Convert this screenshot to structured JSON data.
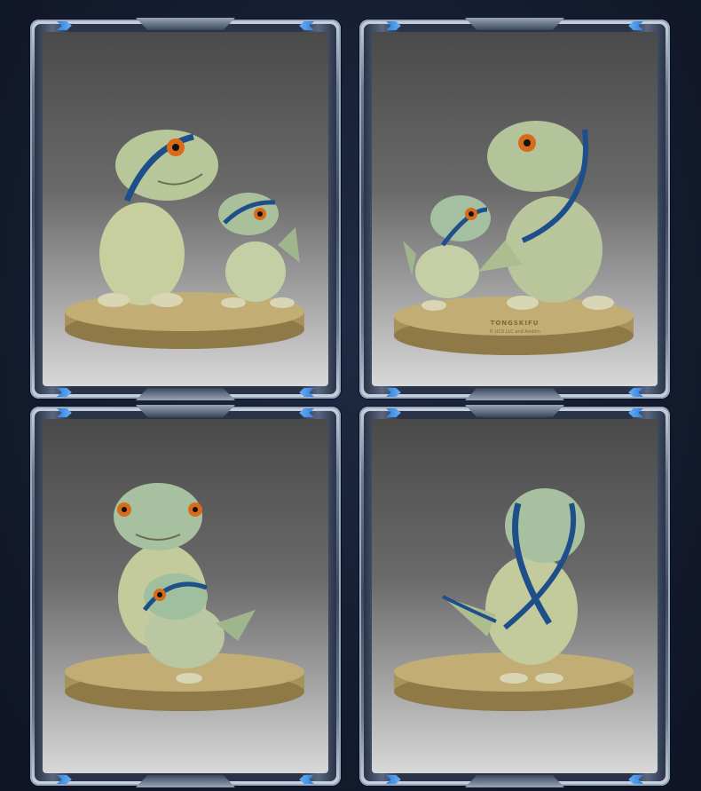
{
  "figure": {
    "base_text": "TONGSKIFU",
    "base_subtext": "© UCS LLC and Amblin"
  },
  "colors": {
    "background": "#141b2e",
    "frame_accent": "#8fd0ff",
    "base_gold": "#b8a36a",
    "skin": "#c7cf9f",
    "stripe_blue": "#1e4f8a",
    "eye_orange": "#d86a1a"
  },
  "panels": [
    {
      "view": "front-pair"
    },
    {
      "view": "side-pair-with-label"
    },
    {
      "view": "stacked-front"
    },
    {
      "view": "back"
    }
  ]
}
